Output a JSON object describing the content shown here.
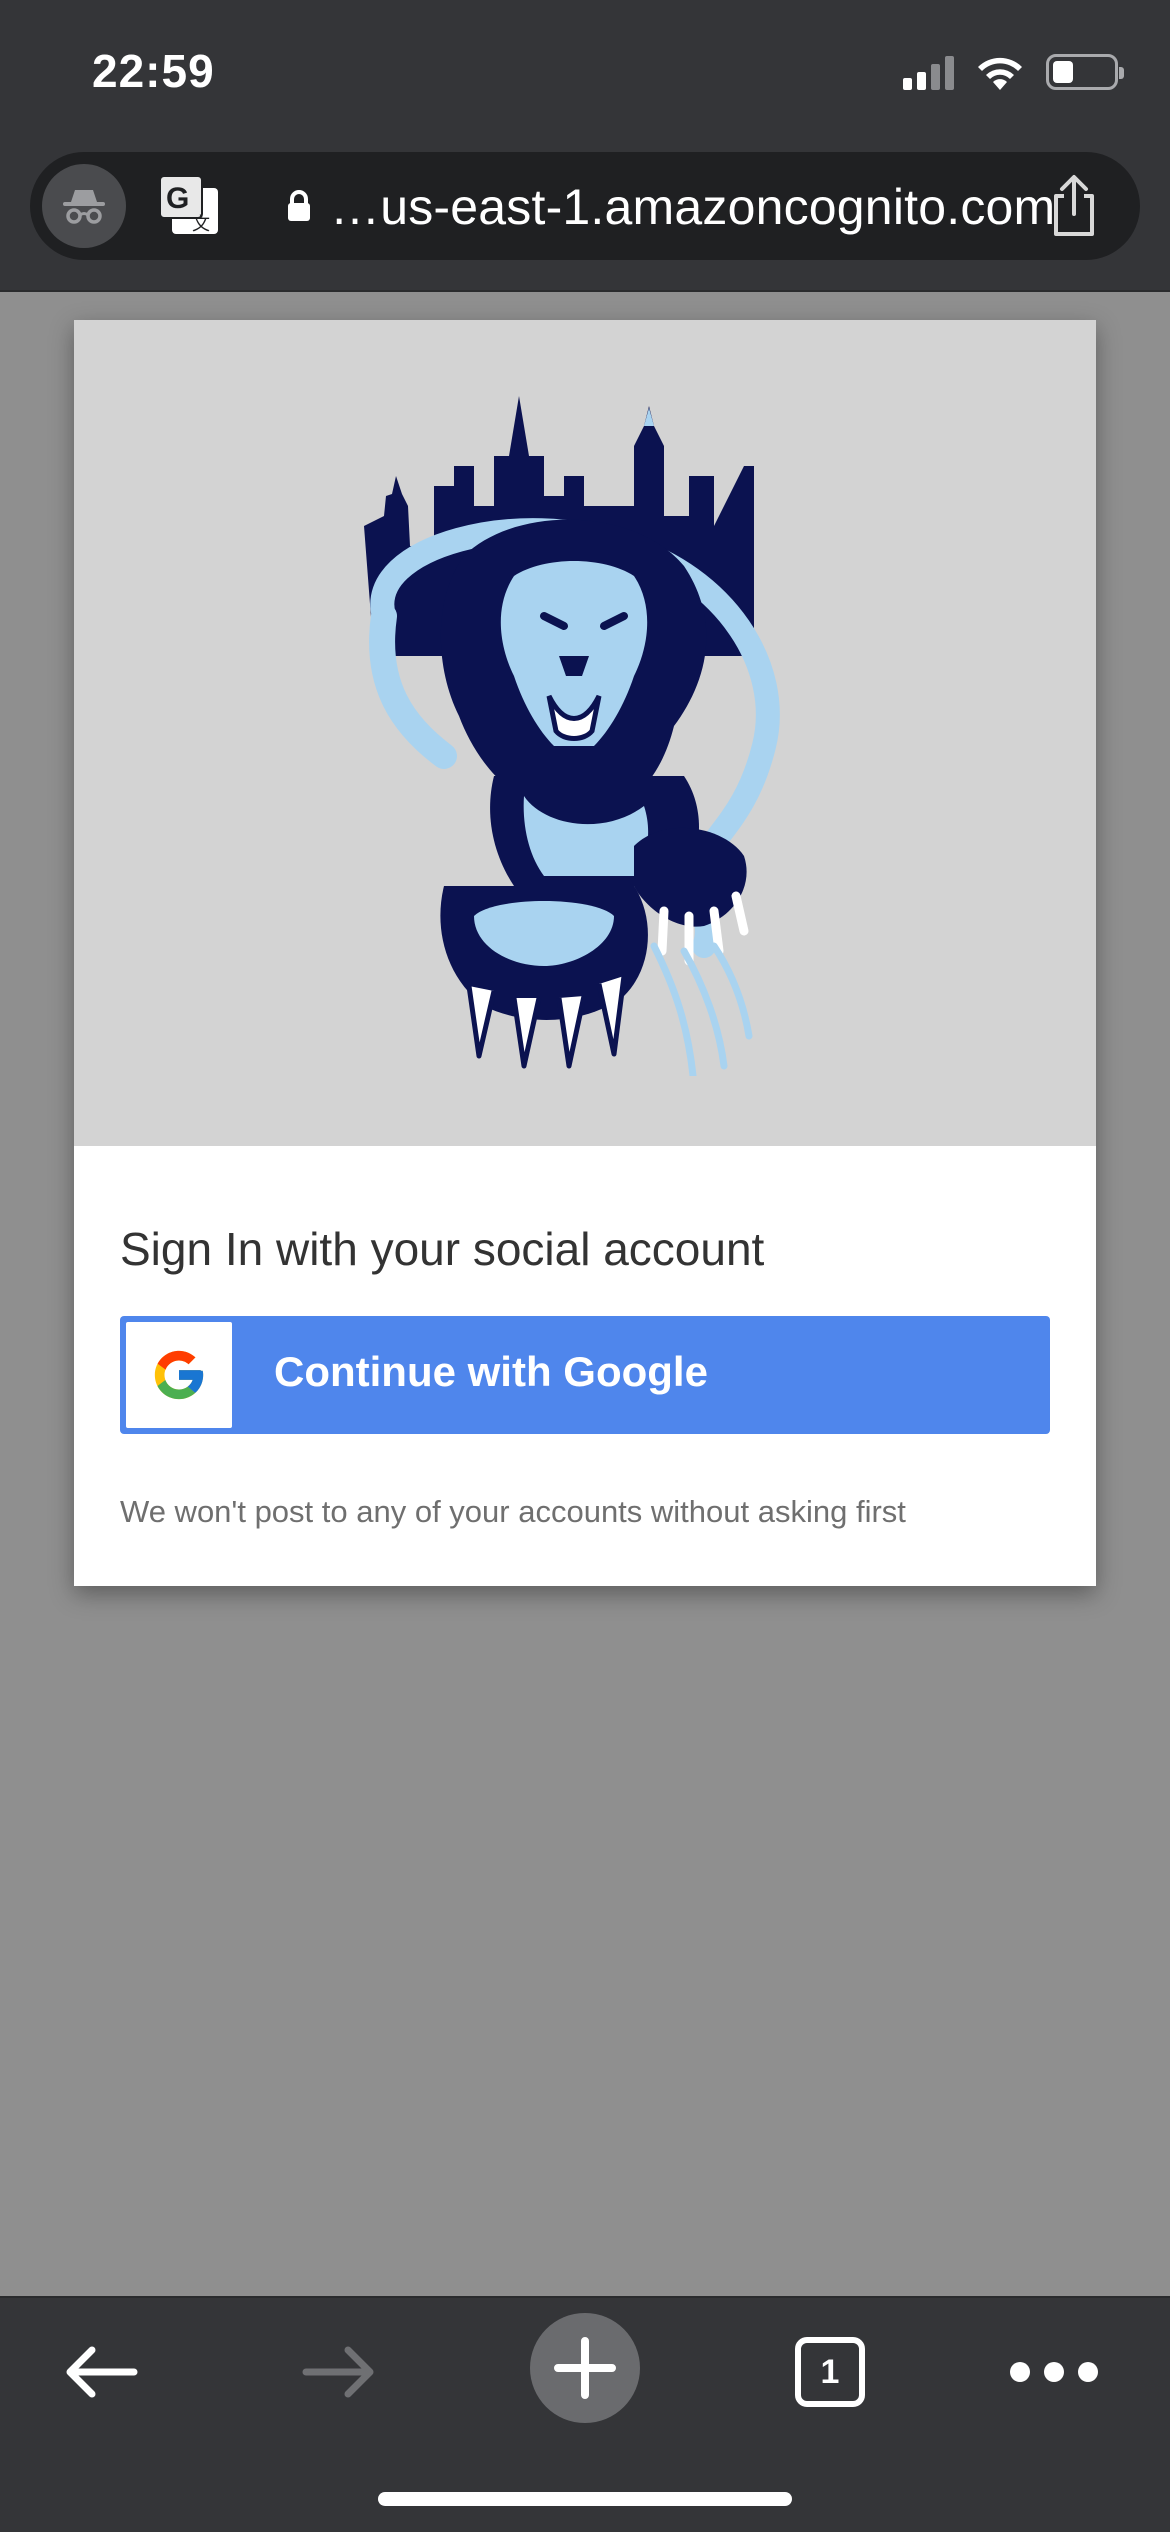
{
  "status_bar": {
    "time": "22:59"
  },
  "browser": {
    "url": "…us-east-1.amazoncognito.com",
    "tab_count": "1"
  },
  "login": {
    "title": "Sign In with your social account",
    "google_button_label": "Continue with Google",
    "notice": "We won't post to any of your accounts without asking first"
  },
  "icons": {
    "incognito": "incognito-icon",
    "translate": "translate-icon",
    "lock": "lock-icon",
    "share": "share-icon",
    "back": "back-arrow-icon",
    "forward": "forward-arrow-icon",
    "new_tab": "plus-icon",
    "menu": "more-dots-icon"
  },
  "colors": {
    "chrome_bg": "#343538",
    "page_bg": "#8f8f8f",
    "google_blue": "#4f86ec",
    "logo_navy": "#0b1250",
    "logo_light": "#a9d3f0"
  }
}
